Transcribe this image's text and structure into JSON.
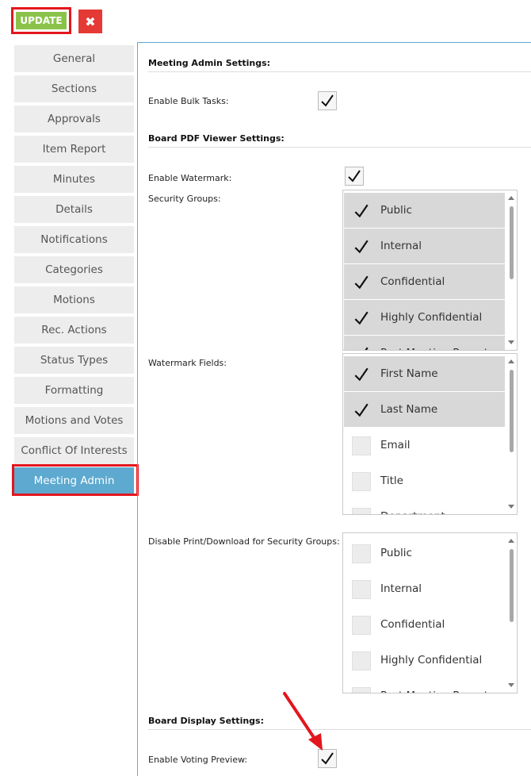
{
  "toolbar": {
    "update_label": "UPDATE",
    "close_glyph": "✖"
  },
  "sidebar": {
    "items": [
      {
        "label": "General"
      },
      {
        "label": "Sections"
      },
      {
        "label": "Approvals"
      },
      {
        "label": "Item Report"
      },
      {
        "label": "Minutes"
      },
      {
        "label": "Details"
      },
      {
        "label": "Notifications"
      },
      {
        "label": "Categories"
      },
      {
        "label": "Motions"
      },
      {
        "label": "Rec. Actions"
      },
      {
        "label": "Status Types"
      },
      {
        "label": "Formatting"
      },
      {
        "label": "Motions and Votes"
      },
      {
        "label": "Conflict Of Interests"
      },
      {
        "label": "Meeting Admin"
      }
    ],
    "active": "Meeting Admin"
  },
  "content": {
    "meeting_admin": {
      "title": "Meeting Admin Settings:",
      "bulk_tasks_label": "Enable Bulk Tasks:",
      "bulk_tasks_checked": true
    },
    "pdf_viewer": {
      "title": "Board PDF Viewer Settings:",
      "watermark_label": "Enable Watermark:",
      "watermark_checked": true,
      "security_groups_label": "Security Groups:",
      "security_groups": [
        {
          "label": "Public",
          "checked": true
        },
        {
          "label": "Internal",
          "checked": true
        },
        {
          "label": "Confidential",
          "checked": true
        },
        {
          "label": "Highly Confidential",
          "checked": true
        },
        {
          "label": "Post Meeting Report",
          "checked": true
        }
      ],
      "watermark_fields_label": "Watermark Fields:",
      "watermark_fields": [
        {
          "label": "First Name",
          "checked": true
        },
        {
          "label": "Last Name",
          "checked": true
        },
        {
          "label": "Email",
          "checked": false
        },
        {
          "label": "Title",
          "checked": false
        },
        {
          "label": "Department",
          "checked": false
        }
      ],
      "disable_print_label": "Disable Print/Download for Security Groups:",
      "disable_print_groups": [
        {
          "label": "Public",
          "checked": false
        },
        {
          "label": "Internal",
          "checked": false
        },
        {
          "label": "Confidential",
          "checked": false
        },
        {
          "label": "Highly Confidential",
          "checked": false
        },
        {
          "label": "Post Meeting Report",
          "checked": false
        }
      ]
    },
    "board_display": {
      "title": "Board Display Settings:",
      "voting_preview_label": "Enable Voting Preview:",
      "voting_preview_checked": true
    }
  },
  "colors": {
    "accent": "#5da9cf",
    "update": "#8bc34a",
    "close": "#e53935",
    "highlight": "#e3161e"
  },
  "icons": {
    "check": "check-icon",
    "close": "close-icon",
    "arrow": "annotation-arrow-icon"
  }
}
